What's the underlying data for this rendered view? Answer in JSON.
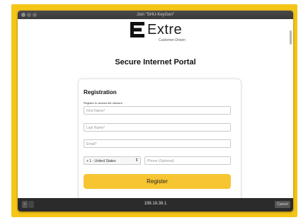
{
  "window": {
    "title": "Join \"SHU-KeyGen\""
  },
  "logo": {
    "brand": "Extre",
    "tagline": "Customer-Driven"
  },
  "portal": {
    "title": "Secure Internet Portal"
  },
  "registration": {
    "title": "Registration",
    "subtitle": "Register to access the network.",
    "first_name_placeholder": "First Name*",
    "last_name_placeholder": "Last Name*",
    "email_placeholder": "Email*",
    "country_selected": "+ 1 - United States",
    "phone_placeholder": "Phone (Optional)",
    "register_label": "Register"
  },
  "bottombar": {
    "back_glyph": "‹",
    "url": "198.18.38.1",
    "cancel_label": "Cancel"
  },
  "icons": {
    "select_arrow": "⇕"
  },
  "colors": {
    "frame_yellow": "#f5c518",
    "register_button": "#f7c531",
    "bottombar": "#2b2b2b"
  }
}
